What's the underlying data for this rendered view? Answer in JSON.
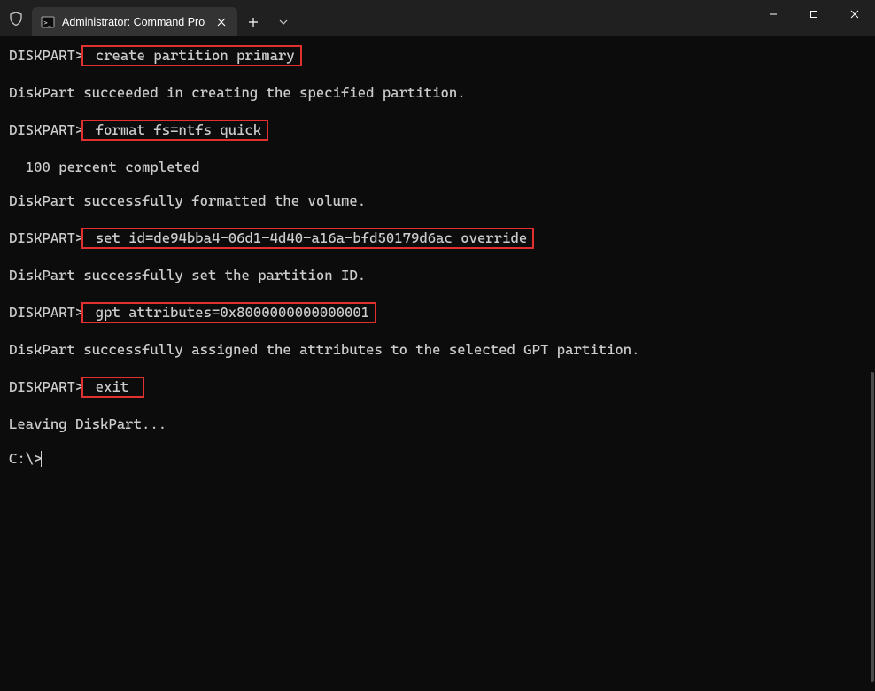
{
  "titlebar": {
    "tab_title": "Administrator: Command Pro"
  },
  "terminal": {
    "lines": [
      {
        "type": "cmd",
        "prompt": "DISKPART>",
        "command": "create partition primary",
        "highlighted": true
      },
      {
        "type": "out",
        "text": "DiskPart succeeded in creating the specified partition."
      },
      {
        "type": "cmd",
        "prompt": "DISKPART>",
        "command": "format fs=ntfs quick",
        "highlighted": true
      },
      {
        "type": "out",
        "text": "  100 percent completed"
      },
      {
        "type": "out",
        "text": "DiskPart successfully formatted the volume."
      },
      {
        "type": "cmd",
        "prompt": "DISKPART>",
        "command": "set id=de94bba4-06d1-4d40-a16a-bfd50179d6ac override",
        "highlighted": true
      },
      {
        "type": "out",
        "text": "DiskPart successfully set the partition ID."
      },
      {
        "type": "cmd",
        "prompt": "DISKPART>",
        "command": "gpt attributes=0x8000000000000001",
        "highlighted": true
      },
      {
        "type": "out",
        "text": "DiskPart successfully assigned the attributes to the selected GPT partition."
      },
      {
        "type": "cmd",
        "prompt": "DISKPART>",
        "command": "exit ",
        "highlighted": true
      },
      {
        "type": "out",
        "text": "Leaving DiskPart..."
      },
      {
        "type": "prompt_only",
        "prompt": "C:\\>"
      }
    ]
  }
}
